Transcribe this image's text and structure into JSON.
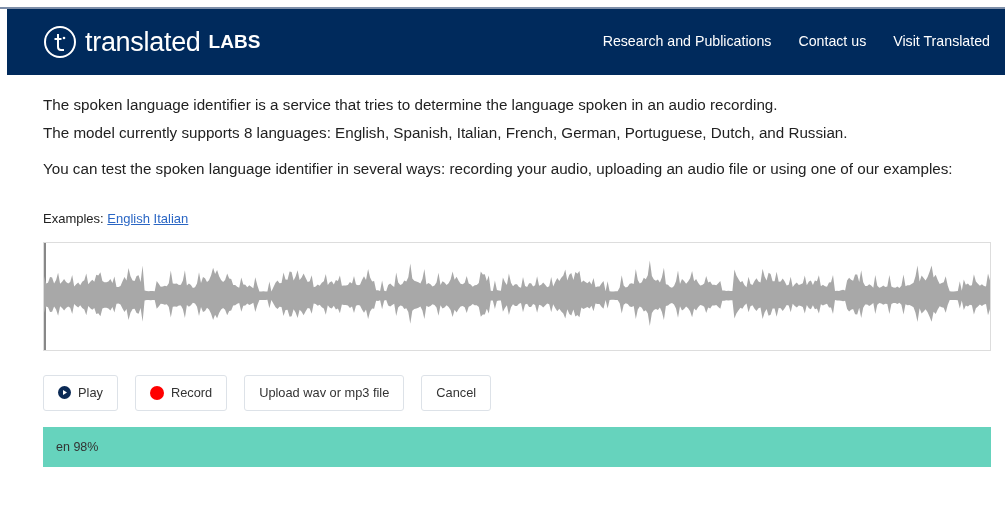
{
  "navbar": {
    "brand": "translated",
    "brand_suffix": "LABS",
    "links": [
      "Research and Publications",
      "Contact us",
      "Visit Translated"
    ]
  },
  "intro": [
    "The spoken language identifier is a service that tries to determine the language spoken in an audio recording.",
    "The model currently supports 8 languages: English, Spanish, Italian, French, German, Portuguese, Dutch, and Russian."
  ],
  "instructions": "You can test the spoken language identifier in several ways: recording your audio, uploading an audio file or using one of our examples:",
  "examples": {
    "label": "Examples:",
    "links": [
      "English",
      "Italian"
    ]
  },
  "buttons": [
    {
      "kind": "play",
      "label": "Play"
    },
    {
      "kind": "record",
      "label": "Record"
    },
    {
      "kind": "plain",
      "label": "Upload wav or mp3 file"
    },
    {
      "kind": "plain",
      "label": "Cancel"
    }
  ],
  "result": "en 98%"
}
